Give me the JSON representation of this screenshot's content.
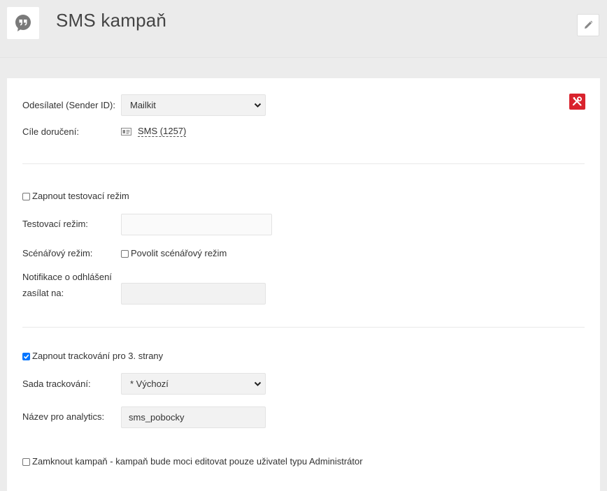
{
  "header": {
    "title": "SMS kampaň",
    "app_icon": "quote-bubble-icon",
    "edit_icon": "pencil-icon"
  },
  "form": {
    "sender": {
      "label": "Odesílatel (Sender ID):",
      "value": "Mailkit"
    },
    "targets": {
      "label": "Cíle doručení:",
      "link": "SMS (1257)",
      "icon": "contact-card-icon"
    },
    "test_mode_toggle": {
      "label": "Zapnout testovací režim",
      "checked": false
    },
    "test_mode": {
      "label": "Testovací režim:",
      "value": ""
    },
    "scenario_mode": {
      "label": "Scénářový režim:",
      "checkbox_label": "Povolit scénářový režim",
      "checked": false
    },
    "unsubscribe_notify": {
      "label_line1": "Notifikace o odhlášení",
      "label_line2": "zasílat na:",
      "value": ""
    },
    "tracking_toggle": {
      "label": "Zapnout trackování pro 3. strany",
      "checked": true
    },
    "tracking_set": {
      "label": "Sada trackování:",
      "value": "* Výchozí"
    },
    "analytics_name": {
      "label": "Název pro analytics:",
      "value": "sms_pobocky"
    },
    "lock_campaign": {
      "label": "Zamknout kampaň - kampaň bude moci editovat pouze uživatel typu Administrátor",
      "checked": false
    }
  },
  "colors": {
    "accent_red": "#d9232d",
    "checkbox_blue": "#0075ff"
  }
}
